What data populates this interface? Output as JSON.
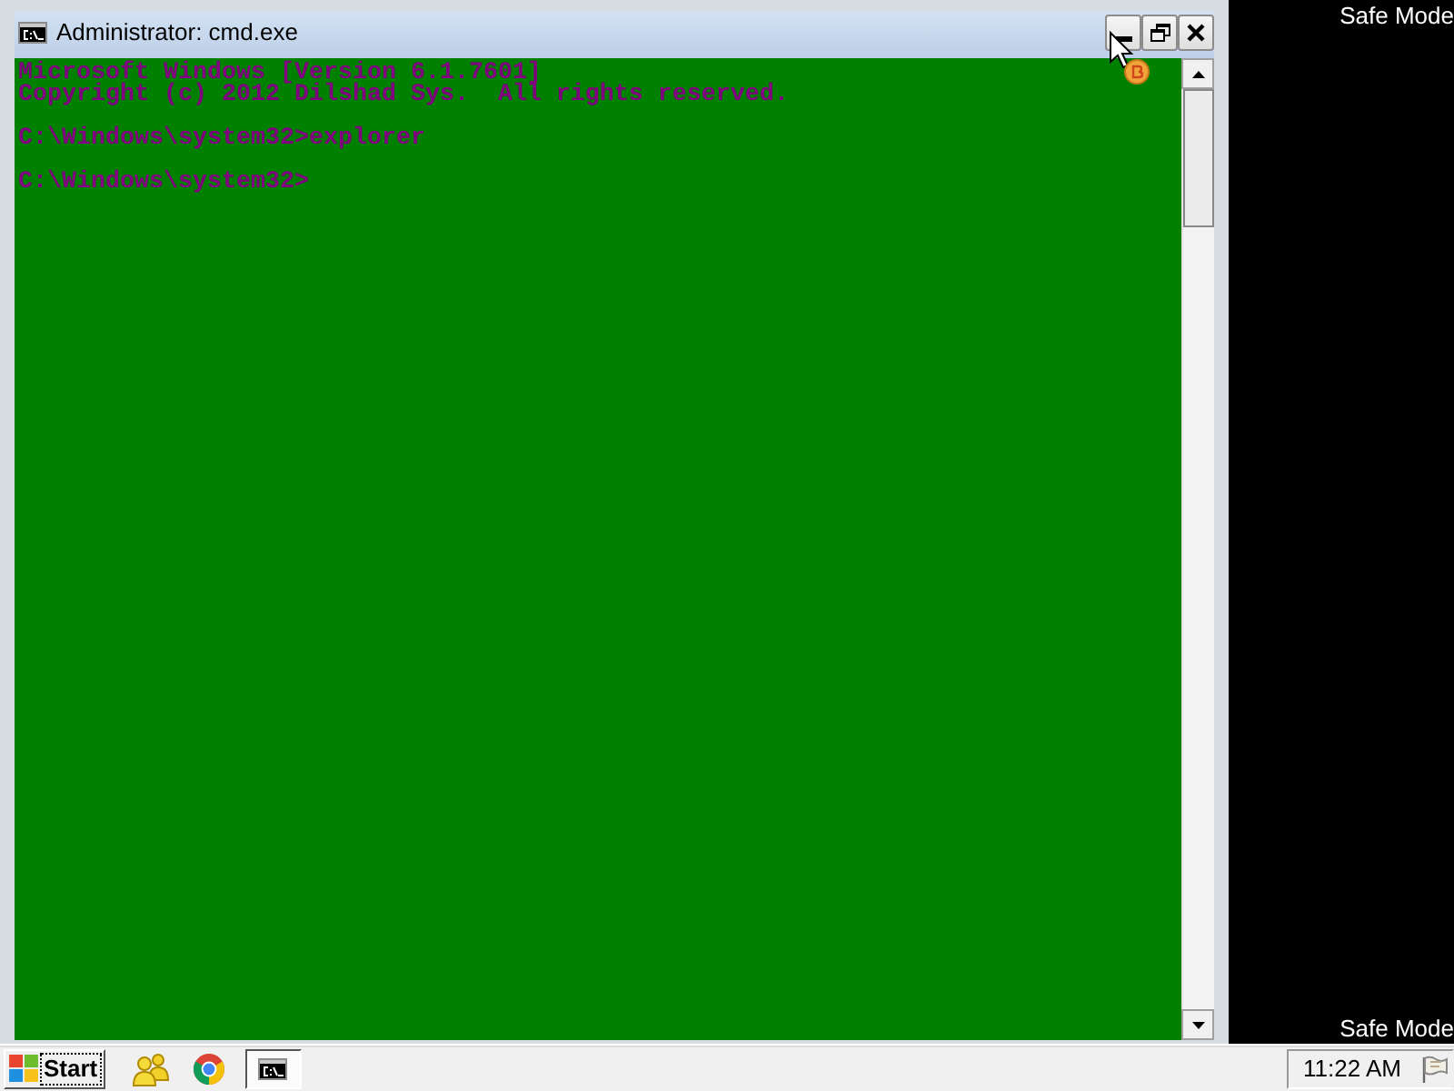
{
  "desktop": {
    "safe_mode_labels": [
      "Safe Mode",
      "Safe Mode"
    ]
  },
  "window": {
    "title": "Administrator: cmd.exe"
  },
  "console": {
    "blocks": [
      [
        "Microsoft Windows [Version 6.1.7601]",
        "Copyright (c) 2012 Dilshad Sys.  All rights reserved."
      ],
      [
        "C:\\Windows\\system32>explorer"
      ],
      [
        "C:\\Windows\\system32>"
      ]
    ]
  },
  "taskbar": {
    "start": {
      "label": "Start",
      "focused": true
    },
    "buttons": [
      {
        "kind": "people",
        "selected": false
      },
      {
        "kind": "browser",
        "selected": false
      },
      {
        "kind": "console",
        "selected": true
      }
    ],
    "clock": "11:22 AM"
  }
}
